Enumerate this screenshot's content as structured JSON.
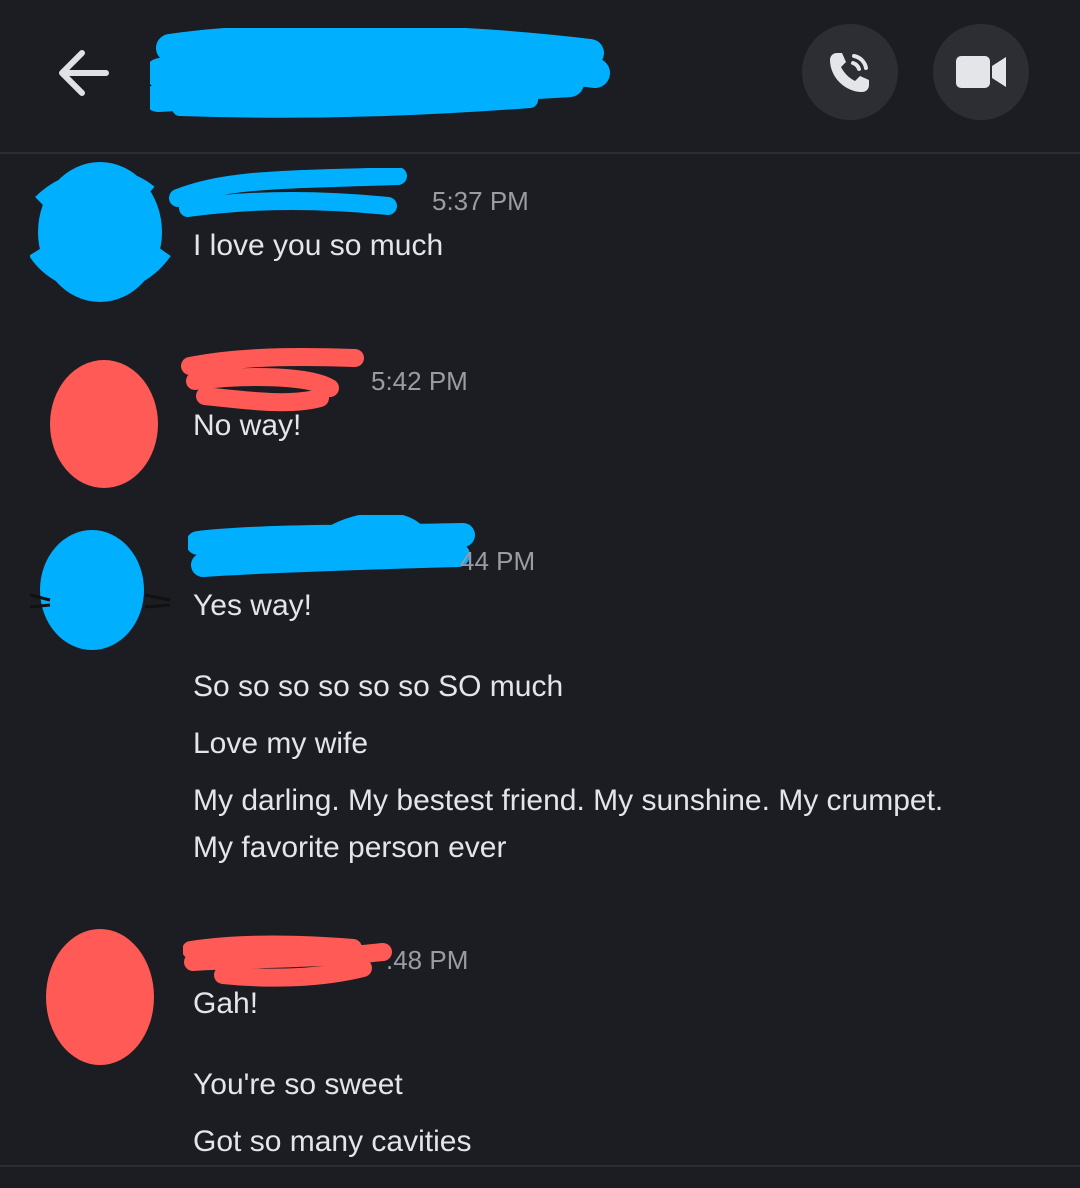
{
  "header": {
    "channel_name": "",
    "back_icon": "arrow-left-icon",
    "call_icon": "phone-call-icon",
    "video_icon": "video-camera-icon"
  },
  "colors": {
    "background": "#1c1d22",
    "button_bg": "#2c2e34",
    "redaction_blue": "#00b0ff",
    "redaction_red": "#ff5a56",
    "timestamp": "#9a9ca3",
    "text": "#e3e5e8"
  },
  "messages": [
    {
      "author": "",
      "time": "5:37 PM",
      "lines": [
        "I love you so much"
      ]
    },
    {
      "author": "",
      "time": "5:42 PM",
      "lines": [
        "No way!"
      ]
    },
    {
      "author": "",
      "time": "44 PM",
      "lines": [
        "Yes way!",
        "So so so so so so SO much",
        "Love my wife",
        "My darling. My bestest friend. My sunshine. My crumpet.",
        "My favorite person ever"
      ]
    },
    {
      "author": "",
      "time": ".48 PM",
      "lines": [
        "Gah!",
        "You're so sweet",
        "Got so many cavities"
      ]
    }
  ]
}
